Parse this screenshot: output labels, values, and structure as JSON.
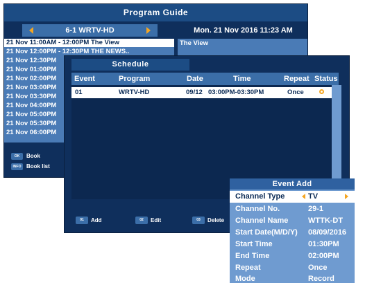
{
  "program_guide": {
    "title": "Program Guide",
    "channel": "6-1 WRTV-HD",
    "datetime": "Mon.  21 Nov 2016 11:23 AM",
    "programs": [
      "21 Nov 11:00AM - 12:00PM The View",
      "21 Nov 12:00PM - 12:30PM THE NEWS..",
      "21 Nov 12:30PM",
      "21 Nov 01:00PM",
      "21 Nov 02:00PM",
      "21 Nov 03:00PM",
      "21 Nov 03:30PM",
      "21 Nov 04:00PM",
      "21 Nov 05:00PM",
      "21 Nov 05:30PM",
      "21 Nov 06:00PM"
    ],
    "description": "The View",
    "keys": [
      {
        "key": "OK",
        "label": "Book"
      },
      {
        "key": "INFO",
        "label": "Book list"
      }
    ]
  },
  "schedule": {
    "title": "Schedule",
    "columns": [
      "Event",
      "Program",
      "Date",
      "Time",
      "Repeat",
      "Status"
    ],
    "rows": [
      {
        "event": "01",
        "program": "WRTV-HD",
        "date": "09/12",
        "time": "03:00PM-03:30PM",
        "repeat": "Once",
        "status_color": "#f5a623"
      }
    ],
    "footer": [
      {
        "key": "01",
        "label": "Add"
      },
      {
        "key": "02",
        "label": "Edit"
      },
      {
        "key": "03",
        "label": "Delete"
      }
    ]
  },
  "event_add": {
    "title": "Event Add",
    "fields": [
      {
        "label": "Channel Type",
        "value": "TV"
      },
      {
        "label": "Channel No.",
        "value": "29-1"
      },
      {
        "label": "Channel Name",
        "value": "WTTK-DT"
      },
      {
        "label": "Start Date(M/D/Y)",
        "value": "08/09/2016"
      },
      {
        "label": "Start Time",
        "value": "01:30PM"
      },
      {
        "label": "End Time",
        "value": "02:00PM"
      },
      {
        "label": "Repeat",
        "value": "Once"
      },
      {
        "label": "Mode",
        "value": "Record"
      }
    ]
  },
  "colors": {
    "window_bg": "#0f2f5c",
    "panel_blue": "#4a7bb6",
    "accent_orange": "#f5a623"
  }
}
